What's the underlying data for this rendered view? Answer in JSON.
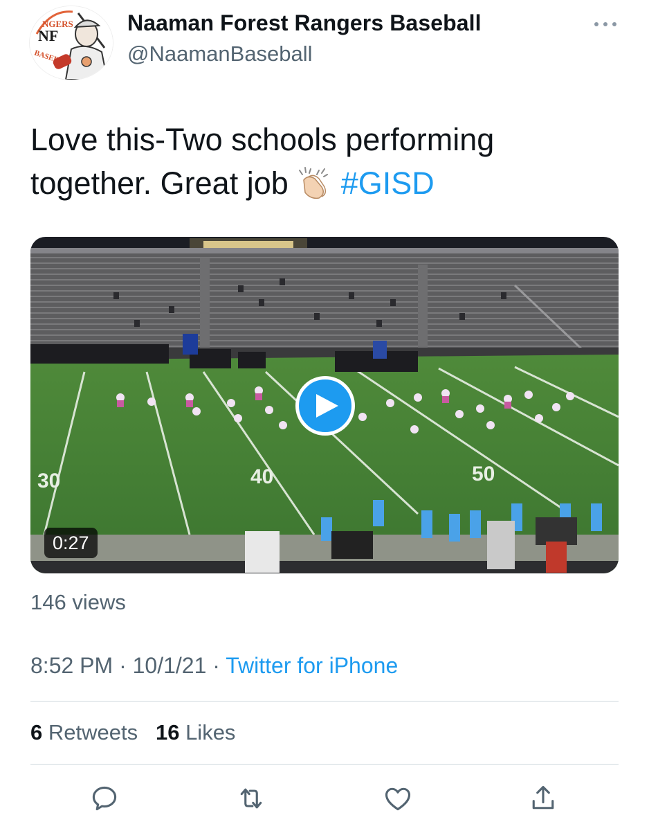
{
  "author": {
    "name": "Naaman Forest Rangers Baseball",
    "handle": "@NaamanBaseball",
    "avatar_icon": "rangers-baseball-logo",
    "logo_text": "RANGERS NF BASEBALL"
  },
  "tweet": {
    "text_line1": "Love this-Two schools performing",
    "text_line2": "together. Great job",
    "emoji": "clapping-hands",
    "hashtag": "#GISD"
  },
  "video": {
    "duration": "0:27",
    "play_icon": "play-icon",
    "yard_markers": [
      "30",
      "40",
      "50"
    ]
  },
  "views": "146 views",
  "meta": {
    "time": "8:52 PM",
    "separator": "·",
    "date": "10/1/21",
    "source": "Twitter for iPhone"
  },
  "stats": {
    "retweets_count": "6",
    "retweets_label": "Retweets",
    "likes_count": "16",
    "likes_label": "Likes"
  },
  "actions": [
    "reply-icon",
    "retweet-icon",
    "like-icon",
    "share-icon"
  ],
  "colors": {
    "accent": "#1d9bf0",
    "secondary_text": "#536471",
    "divider": "#cfd9de"
  }
}
